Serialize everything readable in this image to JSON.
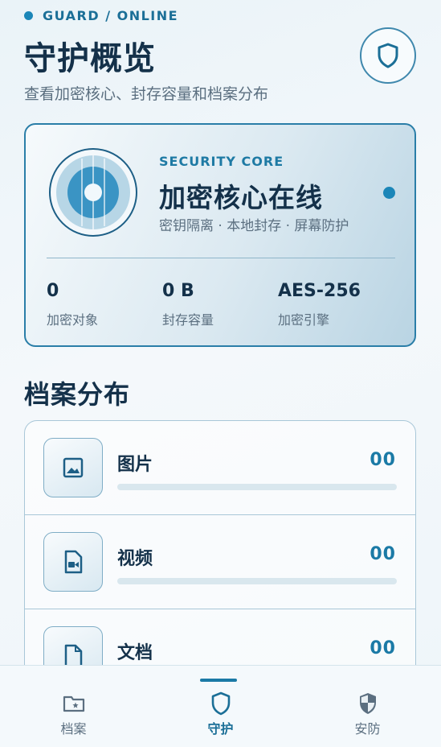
{
  "header": {
    "status": "GUARD / ONLINE",
    "title": "守护概览",
    "subtitle": "查看加密核心、封存容量和档案分布"
  },
  "core": {
    "kicker": "SECURITY CORE",
    "title": "加密核心在线",
    "description": "密钥隔离 · 本地封存 · 屏幕防护",
    "stats": [
      {
        "value": "0",
        "label": "加密对象"
      },
      {
        "value": "0 B",
        "label": "封存容量"
      },
      {
        "value": "AES-256",
        "label": "加密引擎"
      }
    ]
  },
  "distribution": {
    "title": "档案分布",
    "items": [
      {
        "label": "图片",
        "count": "00",
        "fraction": 0,
        "icon": "image-icon"
      },
      {
        "label": "视频",
        "count": "00",
        "fraction": 0,
        "icon": "video-file-icon"
      },
      {
        "label": "文档",
        "count": "00",
        "fraction": 0,
        "icon": "document-icon"
      }
    ]
  },
  "nav": {
    "items": [
      {
        "label": "档案",
        "icon": "folder-star-icon",
        "active": false
      },
      {
        "label": "守护",
        "icon": "shield-icon",
        "active": true
      },
      {
        "label": "安防",
        "icon": "security-shield-icon",
        "active": false
      }
    ]
  },
  "colors": {
    "accent": "#1b86b8",
    "title": "#14314a",
    "muted": "#5b6f80"
  }
}
